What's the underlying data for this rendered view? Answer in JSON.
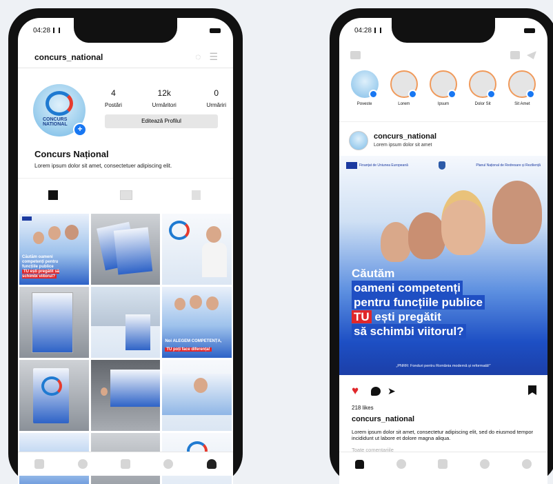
{
  "status": {
    "time": "04:28"
  },
  "profile": {
    "username": "concurs_national",
    "logo_text": "CONCURS NATIONAL",
    "stats": [
      {
        "value": "4",
        "label": "Postări"
      },
      {
        "value": "12k",
        "label": "Urmăritori"
      },
      {
        "value": "0",
        "label": "Urmăriri"
      }
    ],
    "edit_label": "Editează Profilul",
    "display_name": "Concurs Național",
    "bio": "Lorem ipsum dolor sit amet, consectetuer adipiscing elit.",
    "grid_captions": [
      "Căutăm oameni competenți pentru funcțiile publice",
      "TU ești pregătit să schimbi viitorul?",
      "Noi ALEGEM COMPETENȚA,",
      "TU poți face diferența!"
    ]
  },
  "feed": {
    "stories": [
      {
        "label": "Poveste",
        "own": true
      },
      {
        "label": "Lorem"
      },
      {
        "label": "Ipsum"
      },
      {
        "label": "Dolor Sit"
      },
      {
        "label": "Sit Amet"
      }
    ],
    "post": {
      "username": "concurs_national",
      "location": "Lorem ipsum dolor sit amet",
      "logo_left": "Finanțat de Uniunea Europeană",
      "logo_right": "Planul Național de Redresare și Reziliență",
      "headline_1": "Căutăm",
      "headline_2": "oameni competenți",
      "headline_3": "pentru funcțiile publice",
      "headline_4a": "TU",
      "headline_4b": " ești pregătit",
      "headline_5": "să schimbi viitorul?",
      "strip": "„PNRR: Fonduri pentru România modernă și reformată!”",
      "likes": "218 likes",
      "caption_user": "concurs_national",
      "caption": "Lorem ipsum dolor sit amet, consectetur adipiscing elit, sed do eiusmod tempor incididunt ut labore et dolore magna aliqua.",
      "comments_link": "Toate comentariile"
    }
  },
  "colors": {
    "accent": "#1877f2",
    "like": "#e0272b",
    "brand_blue": "#1f4fc3"
  },
  "icons": [
    "search-icon",
    "home-icon",
    "add-icon",
    "heart-icon",
    "profile-icon",
    "camera-icon",
    "send-icon",
    "bookmark-icon",
    "comment-icon"
  ]
}
